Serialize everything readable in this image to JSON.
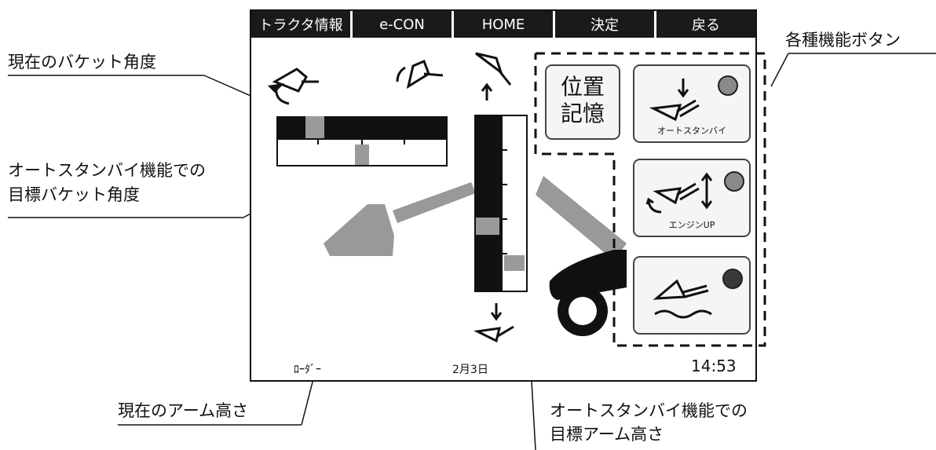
{
  "callouts": {
    "current_bucket_angle": "現在のバケット角度",
    "target_bucket_angle_line1": "オートスタンバイ機能での",
    "target_bucket_angle_line2": "目標バケット角度",
    "current_arm_height": "現在のアーム高さ",
    "target_arm_height_line1": "オートスタンバイ機能での",
    "target_arm_height_line2": "目標アーム高さ",
    "function_buttons": "各種機能ボタン"
  },
  "topbar": {
    "tabs": [
      "トラクタ情報",
      "e-CON",
      "HOME",
      "決定",
      "戻る"
    ]
  },
  "buttons": {
    "position_memory_line1": "位置",
    "position_memory_line2": "記憶",
    "auto_standby_label": "オートスタンバイ",
    "engine_up_label": "エンジンUP"
  },
  "status": {
    "mode": "ﾛｰﾀﾞｰ",
    "date": "2月3日",
    "time": "14:53"
  },
  "indicators": {
    "current_bucket_angle_fraction": 0.17,
    "target_bucket_angle_fraction": 0.5,
    "current_arm_height_fraction": 0.58,
    "target_arm_height_fraction": 0.1
  },
  "colors": {
    "screen_bg": "#ffffff",
    "bar_fill": "#111111",
    "marker_gray": "#9a9a9a",
    "led_gray": "#8a8a8a",
    "led_dark": "#3a3a3a"
  }
}
